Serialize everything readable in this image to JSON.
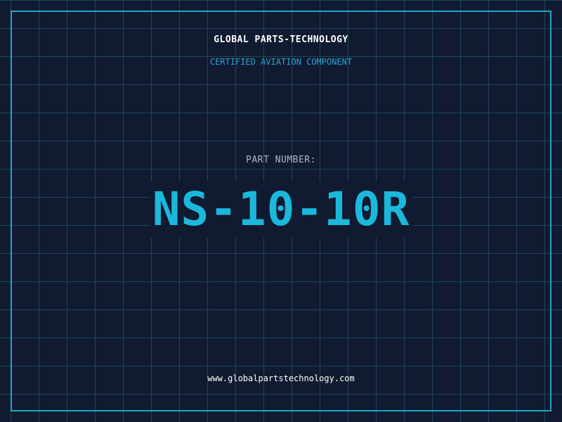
{
  "header": {
    "company": "GLOBAL PARTS-TECHNOLOGY",
    "tagline": "CERTIFIED AVIATION COMPONENT"
  },
  "part": {
    "label": "PART NUMBER:",
    "number": "NS-10-10R"
  },
  "footer": {
    "website": "www.globalpartstechnology.com"
  },
  "colors": {
    "background": "#101a30",
    "grid": "#1e4858",
    "frame": "#20a6cb",
    "accent": "#1cb8dc"
  }
}
